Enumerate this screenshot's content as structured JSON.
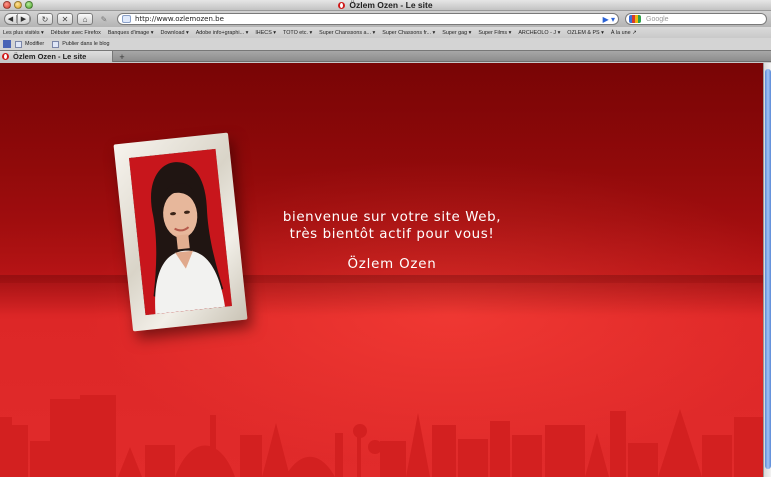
{
  "window": {
    "title": "Özlem Ozen - Le site"
  },
  "toolbar": {
    "back_icon": "back-arrow-icon",
    "forward_icon": "forward-arrow-icon",
    "url": "http://www.ozlemozen.be",
    "search_placeholder": "Google"
  },
  "bookmarks": [
    "Les plus visités ▾",
    "Débuter avec Firefox",
    "Banques d'image ▾",
    "Download ▾",
    "Adobe info+graphi... ▾",
    "IHECS ▾",
    "TOTO etc. ▾",
    "Super Chanssons a... ▾",
    "Super Chassons fr... ▾",
    "Super gag ▾",
    "Super Films ▾",
    "ARCHEOLO - J ▾",
    "OZLEM & PS ▾",
    "À la une ↗"
  ],
  "extensions": [
    {
      "label": "Modifier"
    },
    {
      "label": "Publier dans le blog"
    }
  ],
  "tab": {
    "label": "Özlem Ozen - Le site",
    "add_label": "+"
  },
  "page": {
    "headline_line1": "bienvenue sur votre site Web,",
    "headline_line2": "très bientôt actif pour vous!",
    "name": "Özlem Ozen"
  },
  "colors": {
    "background_top": "#9e0a0b",
    "background_bottom": "#e12b2b",
    "skyline": "#d8201f",
    "text": "#ffffff",
    "frame": "#e8e4dc"
  }
}
